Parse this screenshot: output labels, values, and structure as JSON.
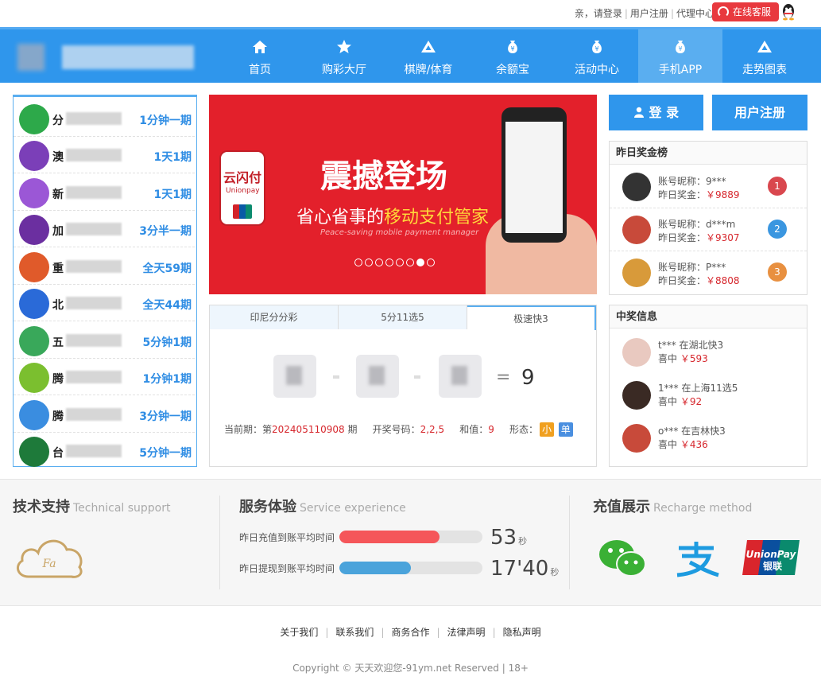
{
  "topbar": {
    "greeting": "亲，请登录",
    "register": "用户注册",
    "agent": "代理中心",
    "service": "在线客服"
  },
  "nav": {
    "items": [
      {
        "label": "首页",
        "icon": "home-icon"
      },
      {
        "label": "购彩大厅",
        "icon": "star-icon"
      },
      {
        "label": "棋牌/体育",
        "icon": "triangle-icon"
      },
      {
        "label": "余额宝",
        "icon": "money-bag-icon"
      },
      {
        "label": "活动中心",
        "icon": "money-bag-icon"
      },
      {
        "label": "手机APP",
        "icon": "money-bag-icon"
      },
      {
        "label": "走势图表",
        "icon": "triangle-icon"
      }
    ],
    "active_index": 5
  },
  "games": [
    {
      "name": "分",
      "period": "1分钟一期",
      "color": "#2da94a"
    },
    {
      "name": "澳",
      "period": "1天1期",
      "color": "#7b3fb8"
    },
    {
      "name": "新",
      "period": "1天1期",
      "color": "#9b57d6"
    },
    {
      "name": "加",
      "period": "3分半一期",
      "color": "#6b2fa0"
    },
    {
      "name": "重",
      "period": "全天59期",
      "color": "#e05a2a"
    },
    {
      "name": "北",
      "period": "全天44期",
      "color": "#2a6ad8"
    },
    {
      "name": "五",
      "period": "5分钟1期",
      "color": "#39a85a"
    },
    {
      "name": "腾",
      "period": "1分钟1期",
      "color": "#7bbf2f"
    },
    {
      "name": "腾",
      "period": "3分钟一期",
      "color": "#3a8de0"
    },
    {
      "name": "台",
      "period": "5分钟一期",
      "color": "#1e7a3a"
    }
  ],
  "banner": {
    "logo_text": "云闪付",
    "logo_sub": "Unionpay",
    "headline": "震撼登场",
    "subline_prefix": "省心省事的",
    "subline_highlight": "移动支付管家",
    "english": "Peace-saving mobile payment manager",
    "dots_total": 8,
    "dots_active": 7
  },
  "lottery": {
    "tabs": [
      "印尼分分彩",
      "5分11选5",
      "极速快3"
    ],
    "active_tab": 2,
    "sum": "9",
    "equals": "=",
    "period_label": "当前期：第",
    "period_value": "202405110908",
    "period_suffix": "期",
    "draw_label": "开奖号码：",
    "draw_value": "2,2,5",
    "sum_label": "和值：",
    "sum_value": "9",
    "shape_label": "形态：",
    "shape_tags": [
      {
        "text": "小",
        "color": "#f0a020"
      },
      {
        "text": "单",
        "color": "#4a8fe0"
      }
    ]
  },
  "auth": {
    "login": "登 录",
    "register": "用户注册"
  },
  "ranking": {
    "title": "昨日奖金榜",
    "rows": [
      {
        "name": "账号昵称：9***",
        "prize_label": "昨日奖金：",
        "prize": "￥9889",
        "rank": "1",
        "color": "#d9474e"
      },
      {
        "name": "账号昵称：d***m",
        "prize_label": "昨日奖金：",
        "prize": "￥9307",
        "rank": "2",
        "color": "#3a96e0"
      },
      {
        "name": "账号昵称：P***",
        "prize_label": "昨日奖金：",
        "prize": "￥8808",
        "rank": "3",
        "color": "#e89040"
      }
    ]
  },
  "winners": {
    "title": "中奖信息",
    "rows": [
      {
        "who": "t*** 在湖北快3",
        "hit": "喜中",
        "amount": "￥593"
      },
      {
        "who": "1*** 在上海11选5",
        "hit": "喜中",
        "amount": "￥92"
      },
      {
        "who": "o*** 在吉林快3",
        "hit": "喜中",
        "amount": "￥436"
      }
    ]
  },
  "footer": {
    "tech_title": "技术支持",
    "tech_sub": "Technical support",
    "service_title": "服务体验",
    "service_sub": "Service experience",
    "recharge_title": "充值展示",
    "recharge_sub": "Recharge method",
    "bars": [
      {
        "label": "昨日充值到账平均时间",
        "value": "53",
        "unit": "秒",
        "fill": 0.7,
        "color": "#f5565a"
      },
      {
        "label": "昨日提现到账平均时间",
        "value": "17'40",
        "unit": "秒",
        "fill": 0.5,
        "color": "#4aa3db"
      }
    ],
    "links": [
      "关于我们",
      "联系我们",
      "商务合作",
      "法律声明",
      "隐私声明"
    ],
    "copyright": "Copyright © 天天欢迎您-91ym.net Reserved | 18+"
  }
}
